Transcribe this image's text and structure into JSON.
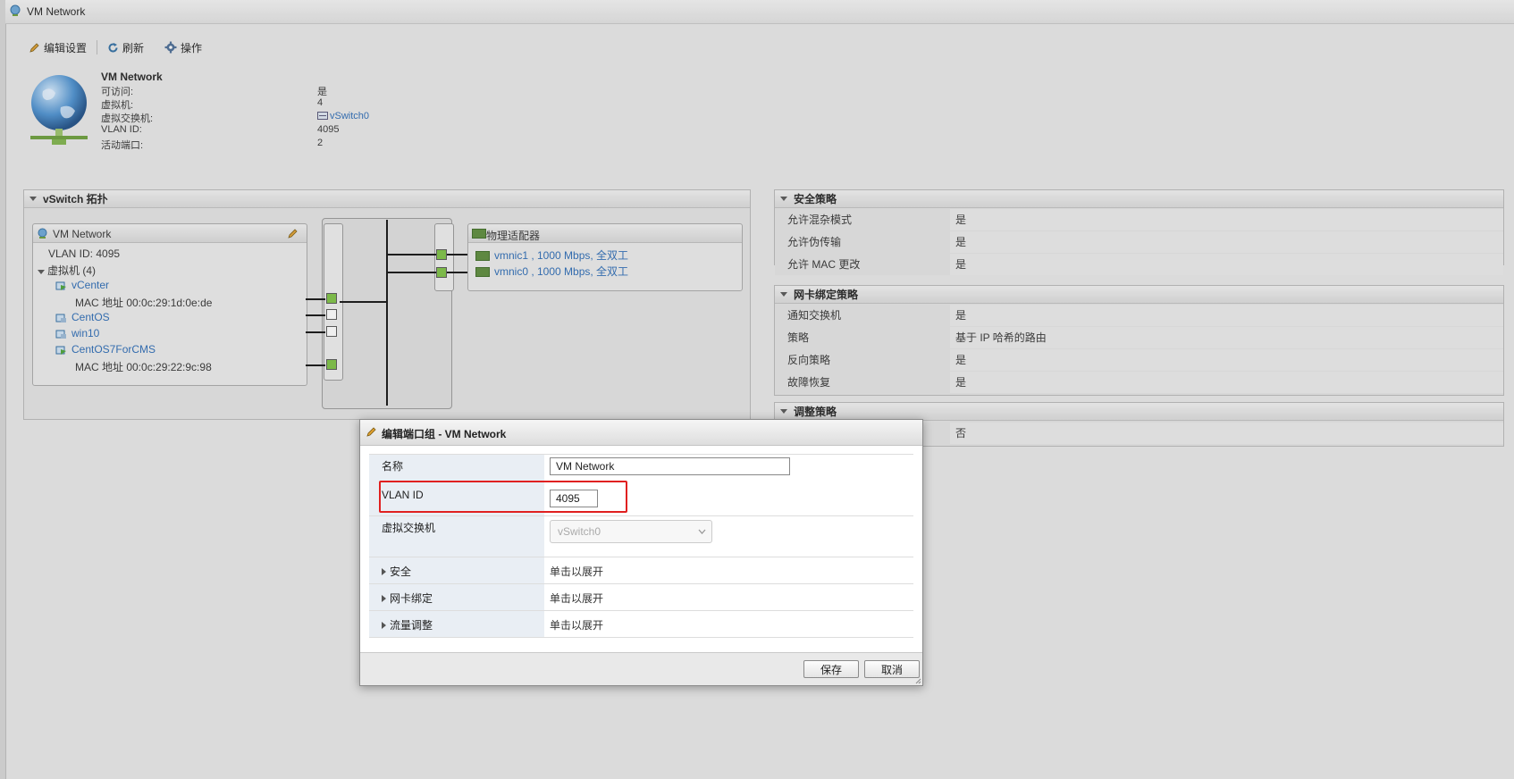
{
  "window": {
    "title": "VM Network"
  },
  "toolbar": {
    "edit_label": "编辑设置",
    "refresh_label": "刷新",
    "actions_label": "操作"
  },
  "header": {
    "name": "VM Network",
    "rows": [
      {
        "label": "可访问:",
        "value": "是"
      },
      {
        "label": "虚拟机:",
        "value": "4"
      },
      {
        "label": "虚拟交换机:",
        "value": "vSwitch0"
      },
      {
        "label": "VLAN ID:",
        "value": "4095"
      },
      {
        "label": "活动端口:",
        "value": "2"
      }
    ]
  },
  "topology": {
    "title": "vSwitch 拓扑",
    "portgroup": {
      "name": "VM Network",
      "vlan": "VLAN ID: 4095",
      "vms_header": "虚拟机 (4)"
    },
    "vms": [
      {
        "name": "vCenter",
        "mac": "MAC 地址 00:0c:29:1d:0e:de"
      },
      {
        "name": "CentOS"
      },
      {
        "name": "win10"
      },
      {
        "name": "CentOS7ForCMS",
        "mac": "MAC 地址 00:0c:29:22:9c:98"
      }
    ],
    "adapters_title": "物理适配器",
    "adapters": [
      {
        "label": "vmnic1 , 1000 Mbps, 全双工"
      },
      {
        "label": "vmnic0 , 1000 Mbps, 全双工"
      }
    ]
  },
  "security_policy": {
    "title": "安全策略",
    "rows": [
      {
        "k": "允许混杂模式",
        "v": "是"
      },
      {
        "k": "允许伪传输",
        "v": "是"
      },
      {
        "k": "允许 MAC 更改",
        "v": "是"
      }
    ]
  },
  "teaming_policy": {
    "title": "网卡绑定策略",
    "rows": [
      {
        "k": "通知交换机",
        "v": "是"
      },
      {
        "k": "策略",
        "v": "基于 IP 哈希的路由"
      },
      {
        "k": "反向策略",
        "v": "是"
      },
      {
        "k": "故障恢复",
        "v": "是"
      }
    ]
  },
  "shaping_policy": {
    "title": "调整策略",
    "rows": [
      {
        "k": "",
        "v": "否"
      }
    ]
  },
  "dialog": {
    "title": "编辑端口组 - VM Network",
    "name_label": "名称",
    "name_value": "VM Network",
    "vlan_label": "VLAN ID",
    "vlan_value": "4095",
    "vswitch_label": "虚拟交换机",
    "vswitch_value": "vSwitch0",
    "sections": [
      {
        "label": "安全",
        "hint": "单击以展开"
      },
      {
        "label": "网卡绑定",
        "hint": "单击以展开"
      },
      {
        "label": "流量调整",
        "hint": "单击以展开"
      }
    ],
    "save_label": "保存",
    "cancel_label": "取消"
  },
  "colors": {
    "link": "#2a6ab5",
    "port_active": "#7dc243",
    "highlight": "#e02020"
  }
}
